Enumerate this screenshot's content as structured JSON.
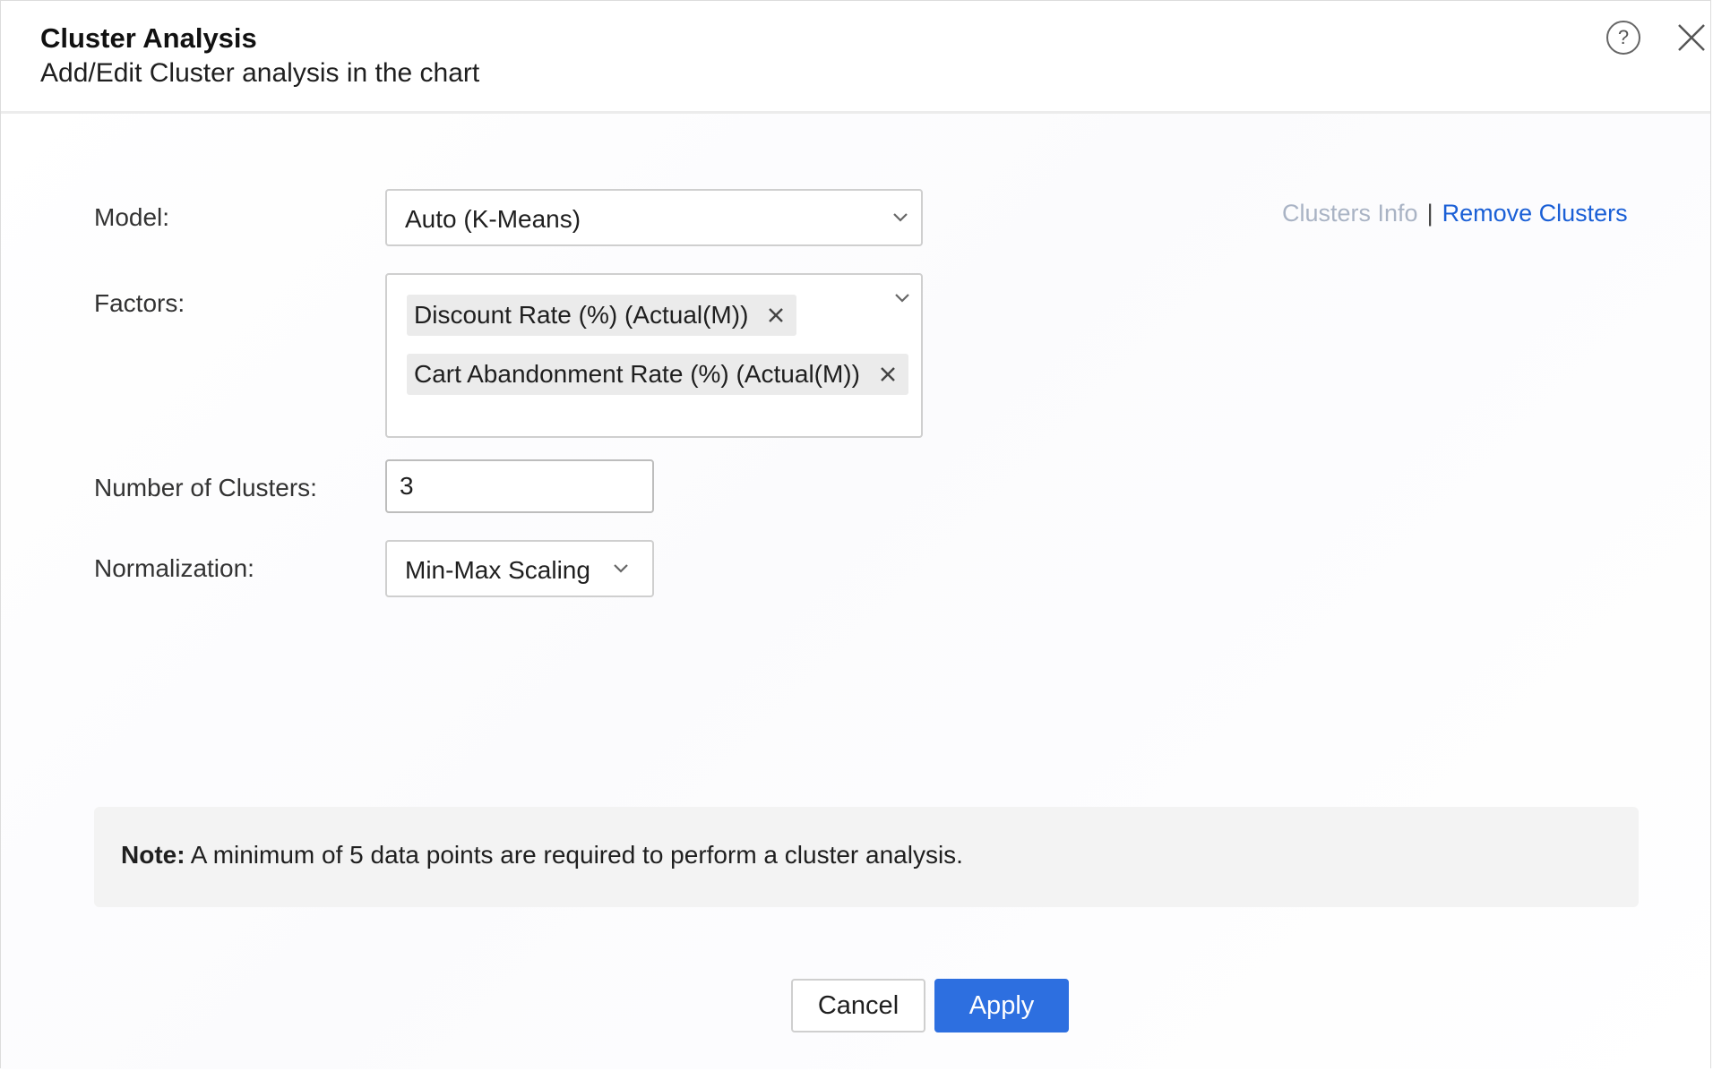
{
  "dialog": {
    "title": "Cluster Analysis",
    "subtitle": "Add/Edit Cluster analysis in the chart",
    "help_icon_glyph": "?"
  },
  "form": {
    "model_label": "Model:",
    "model_value": "Auto (K-Means)",
    "factors_label": "Factors:",
    "factors": [
      "Discount Rate (%) (Actual(M))",
      "Cart Abandonment Rate (%) (Actual(M))"
    ],
    "clusters_label": "Number of Clusters:",
    "clusters_value": "3",
    "normalization_label": "Normalization:",
    "normalization_value": "Min-Max Scaling"
  },
  "links": {
    "info": "Clusters Info",
    "separator": "|",
    "remove": "Remove Clusters"
  },
  "note": {
    "prefix": "Note:",
    "text": " A minimum of 5 data points are required to perform a cluster analysis."
  },
  "buttons": {
    "cancel": "Cancel",
    "apply": "Apply"
  },
  "colors": {
    "accent": "#2d6fe0",
    "link": "#1a5fd6",
    "disabled_link": "#a9b3c4"
  }
}
